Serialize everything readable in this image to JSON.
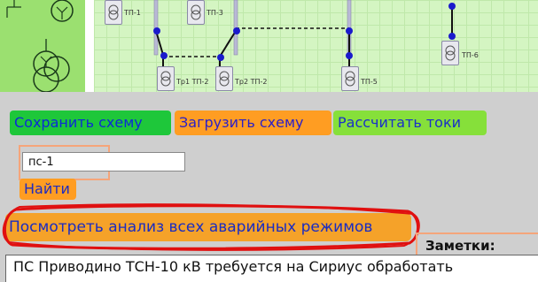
{
  "schematic": {
    "nodes": [
      {
        "label": "ТП-1"
      },
      {
        "label": "ТП-3"
      },
      {
        "label": "Тр1 ТП-2"
      },
      {
        "label": "Тр2 ТП-2"
      },
      {
        "label": "ТП-5"
      },
      {
        "label": "ТП-6"
      }
    ]
  },
  "toolbar": {
    "save_label": "Сохранить схему",
    "load_label": "Загрузить схему",
    "calc_label": "Рассчитать токи"
  },
  "search": {
    "value": "пс-1",
    "button_label": "Найти"
  },
  "analysis": {
    "button_label": "Посмотреть анализ всех аварийных режимов"
  },
  "notes": {
    "label": "Заметки:",
    "text": "ПС Приводино ТСН-10 кВ требуется на Сириус обработать"
  },
  "colors": {
    "save_bg": "#1ec73a",
    "load_bg": "#ff9d22",
    "calc_bg": "#86e03a",
    "analysis_bg": "#f5a229",
    "highlight": "#e01010",
    "node_dot": "#1a1acc"
  }
}
